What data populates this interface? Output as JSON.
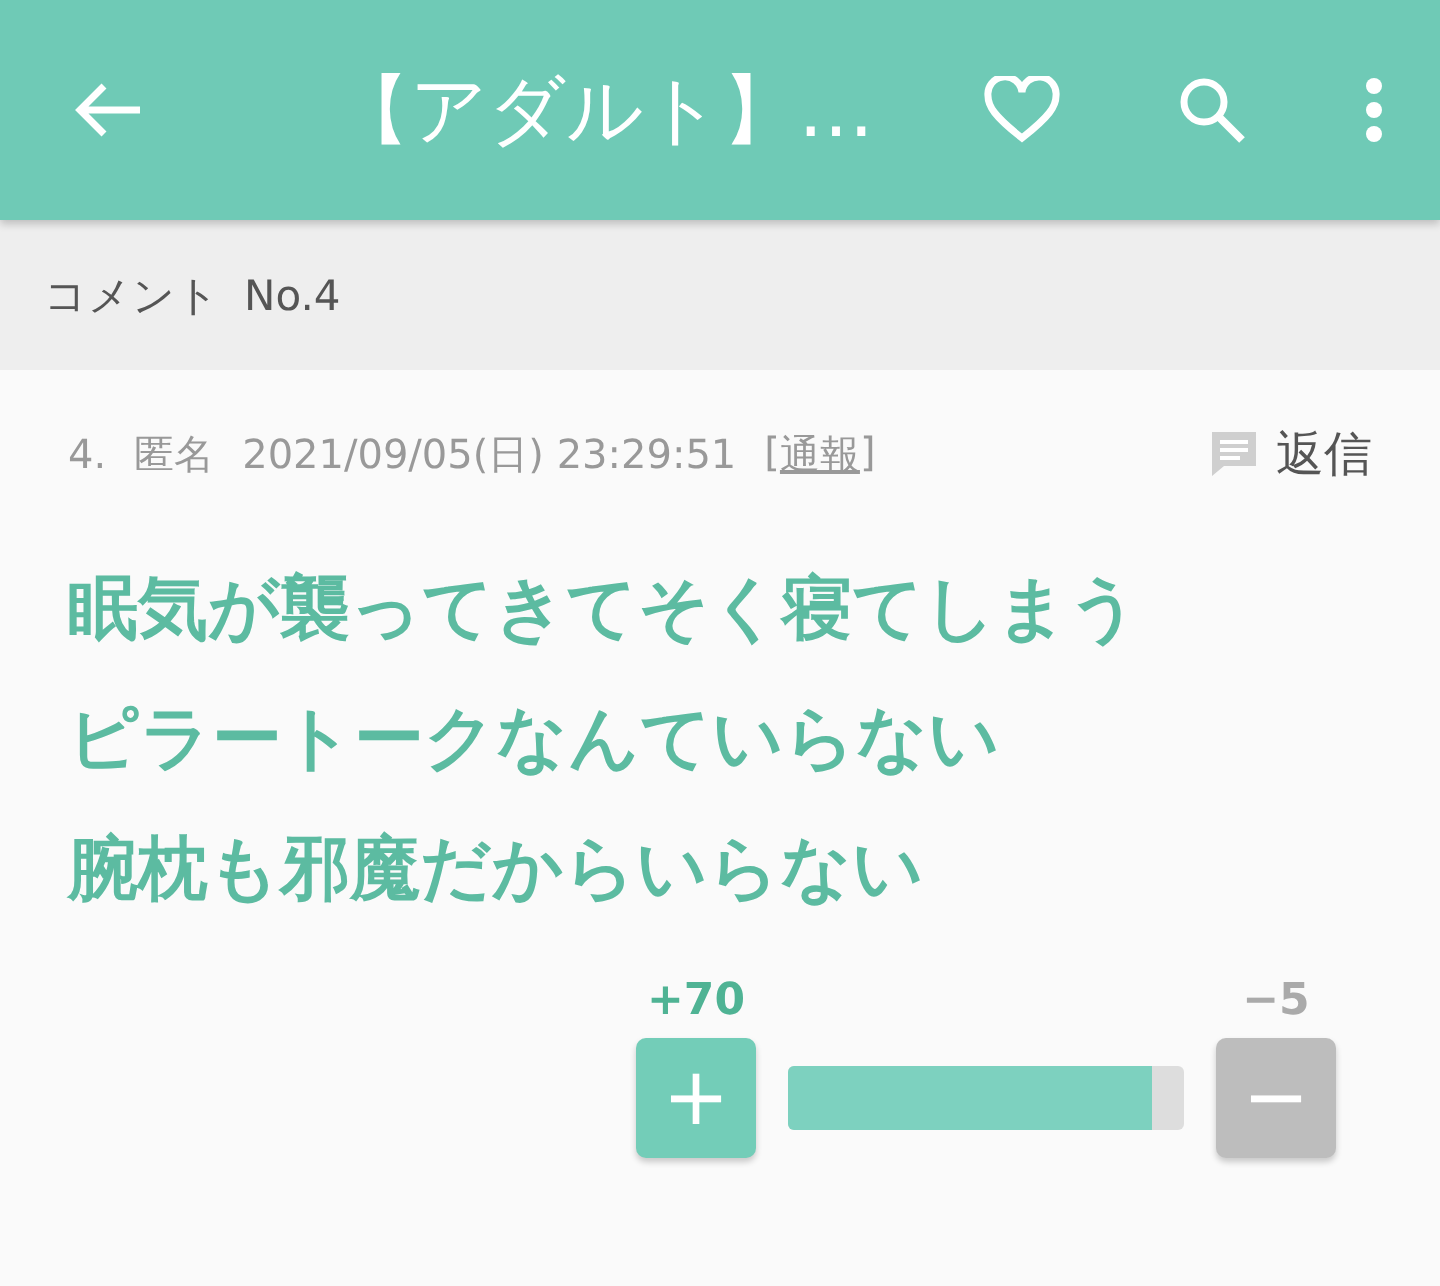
{
  "app_bar": {
    "title": "【アダルト】…"
  },
  "subheader": {
    "label": "コメント",
    "number": "No.4"
  },
  "comment": {
    "index": "4.",
    "author": "匿名",
    "timestamp": "2021/09/05(日) 23:29:51",
    "report_open": "[",
    "report": "通報",
    "report_close": "]",
    "reply": "返信",
    "body_lines": [
      "眠気が襲ってきてそく寝てしまう",
      "ピラートークなんていらない",
      "腕枕も邪魔だからいらない"
    ],
    "vote": {
      "plus_count": "+70",
      "minus_count": "−5",
      "plus_label": "+",
      "minus_label": "−",
      "level": 0.92
    }
  }
}
